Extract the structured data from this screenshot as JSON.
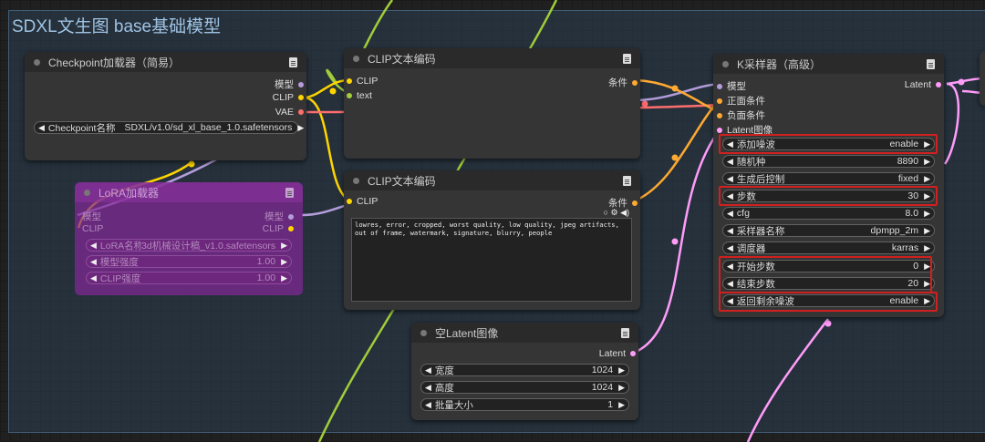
{
  "group": {
    "title": "SDXL文生图 base基础模型"
  },
  "checkpoint_node": {
    "title": "Checkpoint加载器（简易）",
    "outputs": [
      "模型",
      "CLIP",
      "VAE"
    ],
    "widget": {
      "label": "Checkpoint名称",
      "value": "SDXL/v1.0/sd_xl_base_1.0.safetensors"
    }
  },
  "lora_node": {
    "title": "LoRA加载器",
    "input_model": "模型",
    "input_clip": "CLIP",
    "output_model": "模型",
    "output_clip": "CLIP",
    "widgets": [
      {
        "label": "LoRA名称",
        "value": "3d机械设计稿_v1.0.safetensors"
      },
      {
        "label": "模型强度",
        "value": "1.00"
      },
      {
        "label": "CLIP强度",
        "value": "1.00"
      }
    ]
  },
  "clip_text_top": {
    "title": "CLIP文本编码",
    "inputs": [
      "CLIP",
      "text"
    ],
    "output": "条件"
  },
  "clip_text_bottom": {
    "title": "CLIP文本编码",
    "input": "CLIP",
    "output": "条件",
    "text": "lowres, error, cropped, worst quality, low quality, jpeg artifacts, out of frame, watermark, signature, blurry, people"
  },
  "empty_latent": {
    "title": "空Latent图像",
    "output": "Latent",
    "widgets": [
      {
        "label": "宽度",
        "value": "1024"
      },
      {
        "label": "高度",
        "value": "1024"
      },
      {
        "label": "批量大小",
        "value": "1"
      }
    ]
  },
  "ksampler": {
    "title": "K采样器（高级）",
    "inputs": [
      "模型",
      "正面条件",
      "负面条件",
      "Latent图像"
    ],
    "output": "Latent",
    "widgets": [
      {
        "label": "添加噪波",
        "value": "enable"
      },
      {
        "label": "随机种",
        "value": "8890"
      },
      {
        "label": "生成后控制",
        "value": "fixed"
      },
      {
        "label": "步数",
        "value": "30"
      },
      {
        "label": "cfg",
        "value": "8.0"
      },
      {
        "label": "采样器名称",
        "value": "dpmpp_2m"
      },
      {
        "label": "调度器",
        "value": "karras"
      },
      {
        "label": "开始步数",
        "value": "0"
      },
      {
        "label": "结束步数",
        "value": "20"
      },
      {
        "label": "返回剩余噪波",
        "value": "enable"
      }
    ]
  },
  "colors": {
    "model": "#b39ddb",
    "clip": "#ffd500",
    "vae": "#ff6e6e",
    "conditioning": "#ffa931",
    "latent": "#ff9cf9",
    "text": "#a1cd3a",
    "highlight": "#d21f1f"
  }
}
